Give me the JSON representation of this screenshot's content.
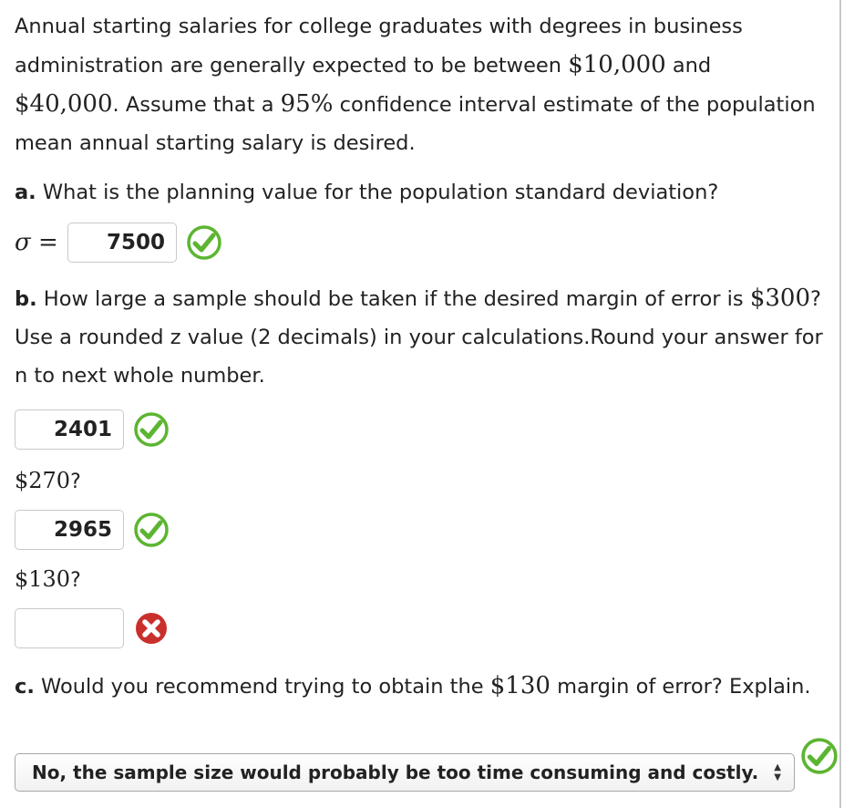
{
  "problem": {
    "intro_1": "Annual starting salaries for college graduates with degrees in business administration are generally expected to be between ",
    "low_salary": "$10,000",
    "intro_and": " and",
    "high_salary": "$40,000",
    "intro_2": ". Assume that a ",
    "confidence": "95%",
    "intro_3": " confidence interval estimate of the population mean annual starting salary is desired."
  },
  "part_a": {
    "label": "a.",
    "question": " What is the planning value for the population standard deviation?",
    "symbol": "σ =",
    "answer": "7500",
    "status": "correct"
  },
  "part_b": {
    "label": "b.",
    "question_1": " How large a sample should be taken if the desired margin of error is ",
    "margin": "$300",
    "question_2": "? Use a rounded z value (2 decimals) in your calculations.Round your answer for n to next whole number.",
    "answer_1": "2401",
    "status_1": "correct",
    "margin_2": "$270",
    "q_mark_2": "?",
    "answer_2": "2965",
    "status_2": "correct",
    "margin_3": "$130",
    "q_mark_3": "?",
    "answer_3": "",
    "status_3": "incorrect"
  },
  "part_c": {
    "label": "c.",
    "question_1": " Would you recommend trying to obtain the ",
    "margin": "$130",
    "question_2": " margin of error? Explain.",
    "selected": "No, the sample size would probably be too time consuming and costly.",
    "status": "correct"
  },
  "colors": {
    "correct": "#5cb531",
    "incorrect": "#c9302c"
  },
  "icons": {
    "correct": "check-circle-icon",
    "incorrect": "x-circle-icon",
    "select": "up-down-arrows-icon"
  }
}
